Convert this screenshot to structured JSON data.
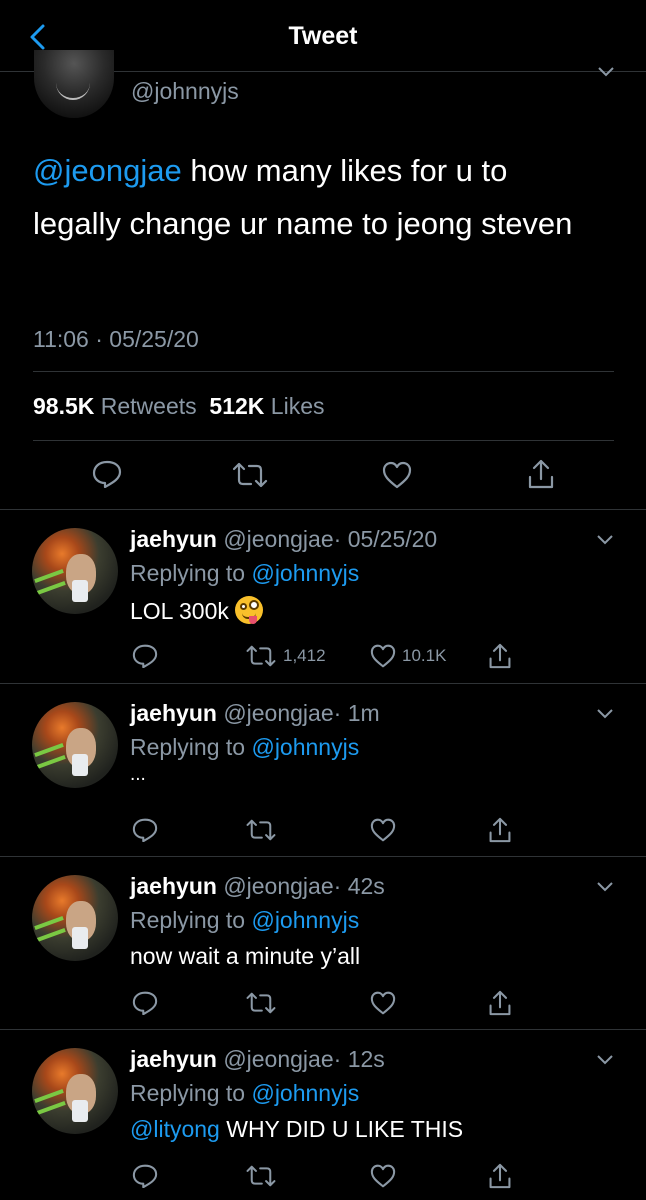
{
  "header": {
    "title": "Tweet"
  },
  "main_tweet": {
    "handle": "@johnnyjs",
    "mention": "@jeongjae",
    "text": " how many likes for u to legally change ur name to jeong steven",
    "timestamp": "11:06 · 05/25/20",
    "retweets_count": "98.5K",
    "retweets_label": "Retweets",
    "likes_count": "512K",
    "likes_label": "Likes"
  },
  "replies": [
    {
      "name": "jaehyun",
      "handle": "@jeongjae",
      "time": "· 05/25/20",
      "replying_prefix": "Replying to ",
      "replying_handle": "@johnnyjs",
      "mention": "",
      "text": "LOL 300k",
      "emoji": "zany-face",
      "retweets": "1,412",
      "likes": "10.1K"
    },
    {
      "name": "jaehyun",
      "handle": "@jeongjae",
      "time": "· 1m",
      "replying_prefix": "Replying to ",
      "replying_handle": "@johnnyjs",
      "mention": "",
      "text": "...",
      "retweets": "",
      "likes": ""
    },
    {
      "name": "jaehyun",
      "handle": "@jeongjae",
      "time": "· 42s",
      "replying_prefix": "Replying to ",
      "replying_handle": "@johnnyjs",
      "mention": "",
      "text": "now wait a minute y’all",
      "retweets": "",
      "likes": ""
    },
    {
      "name": "jaehyun",
      "handle": "@jeongjae",
      "time": "· 12s",
      "replying_prefix": "Replying to ",
      "replying_handle": "@johnnyjs",
      "mention": "@lityong",
      "text": " WHY DID U LIKE THIS",
      "retweets": "",
      "likes": ""
    }
  ],
  "colors": {
    "background": "#000000",
    "accent": "#1d9bf0",
    "secondary_text": "#8b98a5",
    "divider": "#2f3336"
  },
  "icons": [
    "back-chevron-icon",
    "chevron-down-icon",
    "reply-icon",
    "retweet-icon",
    "like-heart-icon",
    "share-icon"
  ]
}
